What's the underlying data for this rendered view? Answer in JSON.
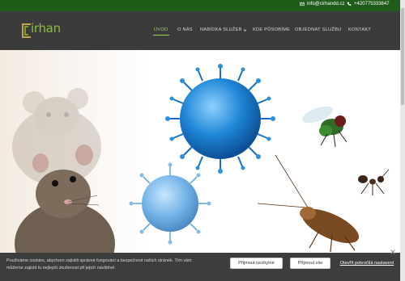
{
  "topbar": {
    "email": "info@cirhandd.cz",
    "phone": "+420775333847",
    "email_icon": "envelope-icon",
    "phone_icon": "phone-icon"
  },
  "nav": {
    "logo_text": "irhan",
    "items": [
      {
        "label": "ÚVOD",
        "active": true
      },
      {
        "label": "O NÁS",
        "active": false
      },
      {
        "label": "NABÍDKA SLUŽEB",
        "active": false,
        "has_dropdown": true
      },
      {
        "label": "KDE PŮSOBÍME",
        "active": false
      },
      {
        "label": "OBJEDNAT SLUŽBU",
        "active": false
      },
      {
        "label": "KONTAKT",
        "active": false
      }
    ]
  },
  "hero": {
    "image_subjects": [
      "rat-image",
      "virus-image",
      "fly-image",
      "ant-image",
      "cockroach-image"
    ]
  },
  "cookie_bar": {
    "text": "Používáme cookies, abychom zajistili správné fungování a bezpečnost našich stránek. Tím vám můžeme zajistit tu nejlepší zkušenost při jejich návštěvě.",
    "accept_necessary": "Přijmout nezbytné",
    "accept_all": "Přijmout vše",
    "advanced_settings": "Otevřít pokročilá nastavení"
  },
  "colors": {
    "topbar": "#1f5c1a",
    "nav_bg": "#3b3b3b",
    "accent": "#a5d35a",
    "cookie_bg": "#3d3d3d",
    "virus": "#1f86d6"
  }
}
